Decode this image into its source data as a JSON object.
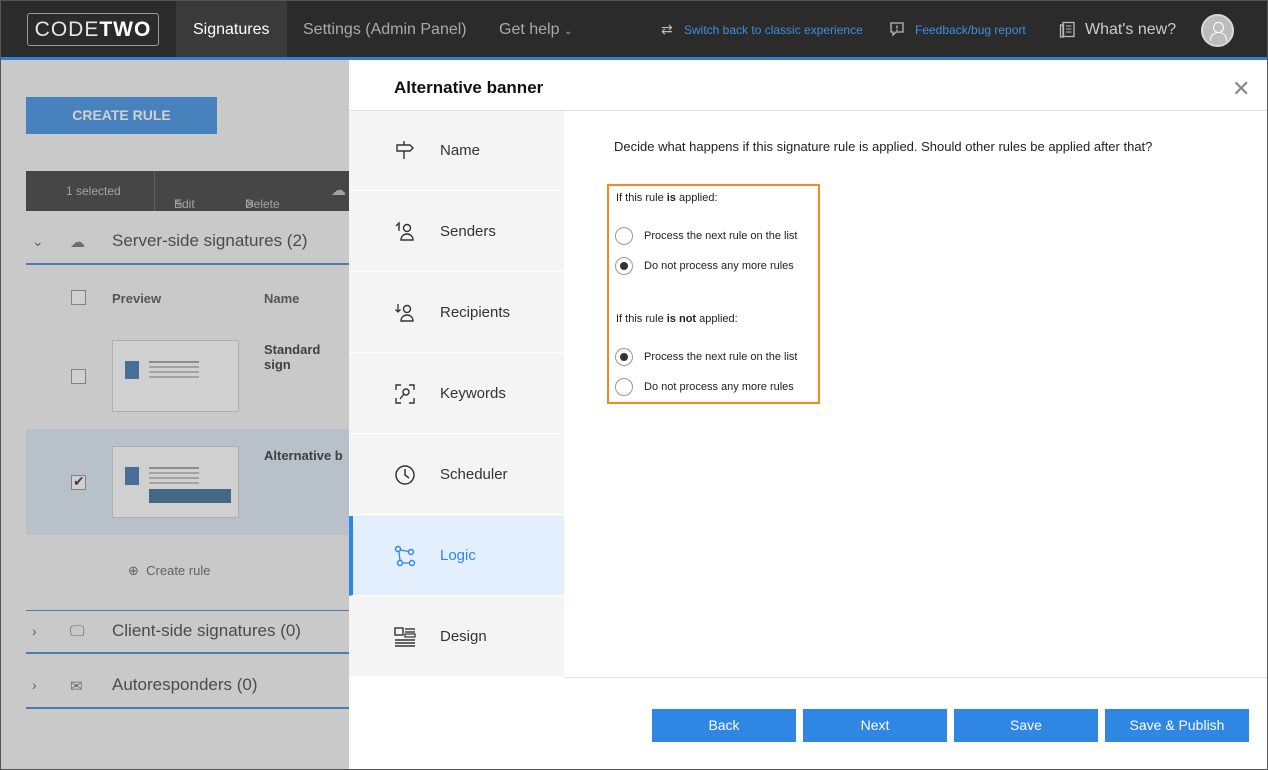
{
  "topnav": {
    "logo_code": "CODE",
    "logo_two": "TWO",
    "tabs": [
      "Signatures",
      "Settings (Admin Panel)",
      "Get help"
    ],
    "switch_link": "Switch back to classic experience",
    "feedback_link": "Feedback/bug report",
    "whats_new": "What's new?"
  },
  "background": {
    "create_rule_button": "CREATE RULE",
    "toolbar": {
      "selected": "1 selected",
      "edit": "Edit",
      "delete": "Delete"
    },
    "groups": [
      {
        "title": "Server-side signatures (2)"
      },
      {
        "title": "Client-side signatures (0)"
      },
      {
        "title": "Autoresponders (0)"
      }
    ],
    "columns": {
      "preview": "Preview",
      "name": "Name"
    },
    "rows": [
      {
        "name": "Standard sign",
        "checked": false
      },
      {
        "name": "Alternative b",
        "checked": true
      }
    ],
    "create_rule_link": "Create rule"
  },
  "modal": {
    "title": "Alternative banner",
    "steps": [
      {
        "label": "Name",
        "icon": "signpost-icon"
      },
      {
        "label": "Senders",
        "icon": "senders-icon"
      },
      {
        "label": "Recipients",
        "icon": "recipients-icon"
      },
      {
        "label": "Keywords",
        "icon": "keywords-icon"
      },
      {
        "label": "Scheduler",
        "icon": "clock-icon"
      },
      {
        "label": "Logic",
        "icon": "logic-icon"
      },
      {
        "label": "Design",
        "icon": "design-icon"
      }
    ],
    "active_step": "Logic",
    "question": "Decide what happens if this signature rule is applied. Should other rules be applied after that?",
    "applied": {
      "heading_pre": "If this rule ",
      "heading_bold": "is",
      "heading_post": " applied:",
      "options": [
        "Process the next rule on the list",
        "Do not process any more rules"
      ],
      "selected": 1
    },
    "not_applied": {
      "heading_pre": "If this rule ",
      "heading_bold": "is not",
      "heading_post": " applied:",
      "options": [
        "Process the next rule on the list",
        "Do not process any more rules"
      ],
      "selected": 0
    },
    "buttons": {
      "back": "Back",
      "next": "Next",
      "save": "Save",
      "save_publish": "Save & Publish"
    }
  },
  "colors": {
    "accent": "#2f87e3",
    "highlight_border": "#f28a1d",
    "nav_bg": "#2b2b2b"
  }
}
